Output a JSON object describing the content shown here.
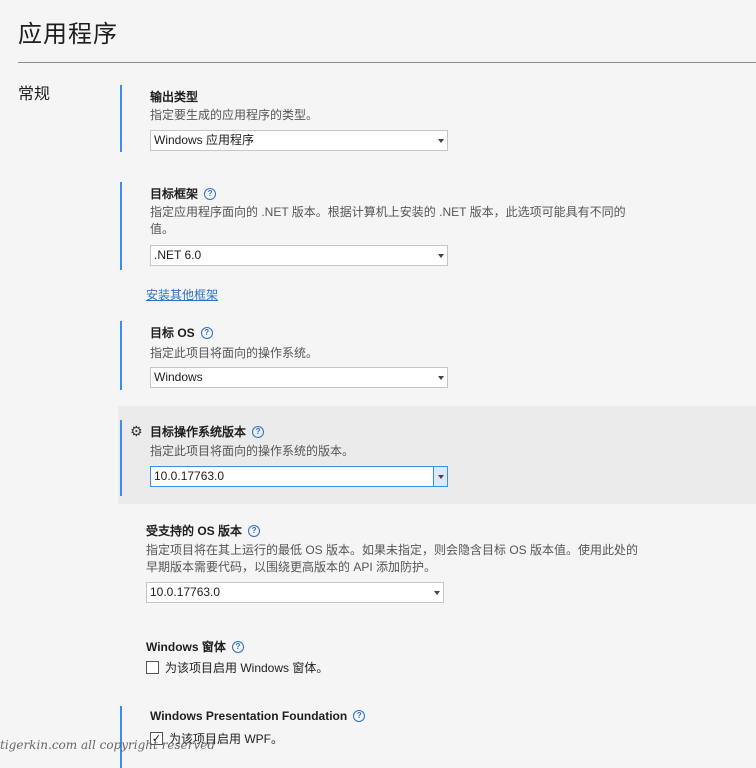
{
  "page": {
    "title": "应用程序",
    "section": "常规"
  },
  "output_type": {
    "heading": "输出类型",
    "desc": "指定要生成的应用程序的类型。",
    "value": "Windows 应用程序"
  },
  "target_framework": {
    "heading": "目标框架",
    "desc": "指定应用程序面向的 .NET 版本。根据计算机上安装的 .NET 版本，此选项可能具有不同的值。",
    "value": ".NET 6.0",
    "install_link": "安装其他框架"
  },
  "target_os": {
    "heading": "目标 OS",
    "desc": "指定此项目将面向的操作系统。",
    "value": "Windows"
  },
  "target_os_version": {
    "heading": "目标操作系统版本",
    "desc": "指定此项目将面向的操作系统的版本。",
    "value": "10.0.17763.0"
  },
  "supported_os_version": {
    "heading": "受支持的 OS 版本",
    "desc": "指定项目将在其上运行的最低 OS 版本。如果未指定，则会隐含目标 OS 版本值。使用此处的早期版本需要代码，以围绕更高版本的 API 添加防护。",
    "value": "10.0.17763.0"
  },
  "windows_forms": {
    "heading": "Windows 窗体",
    "checkbox_label": "为该项目启用 Windows 窗体。",
    "checked": false
  },
  "wpf": {
    "heading": "Windows Presentation Foundation",
    "checkbox_label": "为该项目启用 WPF。",
    "checked": true,
    "check_mark": "✓"
  },
  "icons": {
    "help": "?",
    "gear": "⚙"
  },
  "watermark": "tigerkin.com all copyright reserved",
  "colors": {
    "accent": "#3b8eea",
    "link": "#2f6fc4",
    "highlight_bg": "#ebebeb",
    "page_bg": "#f5f5f5"
  }
}
